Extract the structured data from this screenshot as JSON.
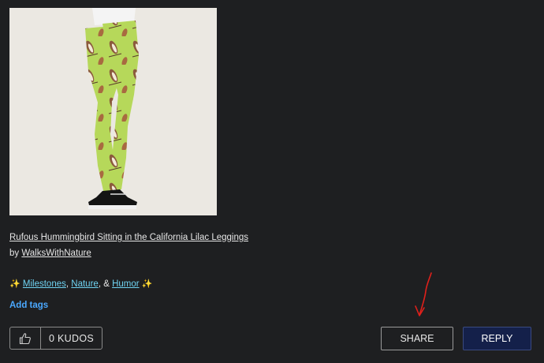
{
  "post": {
    "product_title": "Rufous Hummingbird Sitting in the California Lilac Leggings",
    "by_prefix": "by",
    "author": "WalksWithNature",
    "tags": [
      "Milestones",
      "Nature",
      "Humor"
    ],
    "tag_sep_1": ",",
    "tag_sep_2": ", &",
    "add_tags_label": "Add tags"
  },
  "actions": {
    "kudos_label": "0 KUDOS",
    "share_label": "SHARE",
    "reply_label": "REPLY"
  },
  "icons": {
    "thumb": "thumbs-up-icon",
    "sparkle": "sparkles-icon",
    "annotation": "red-arrow-annotation"
  },
  "colors": {
    "background": "#1e1f21",
    "tag_link": "#6fd3f2",
    "add_tags": "#4aa8ff",
    "reply_bg": "#14204a",
    "annotation": "#e0201b",
    "leggings": "#b6d85a"
  }
}
